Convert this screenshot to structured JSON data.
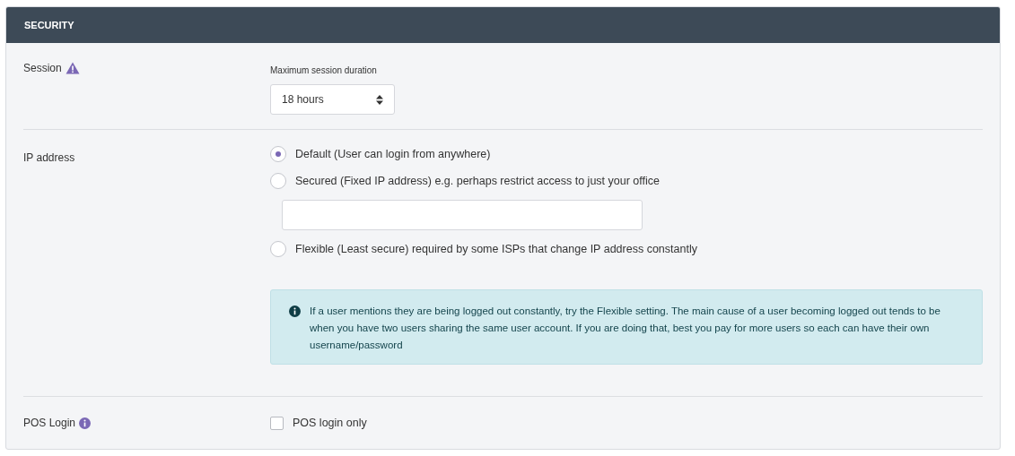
{
  "panel": {
    "title": "SECURITY"
  },
  "session": {
    "label": "Session",
    "field_label": "Maximum session duration",
    "value": "18 hours"
  },
  "ip_address": {
    "label": "IP address",
    "options": [
      {
        "label": "Default (User can login from anywhere)",
        "selected": true
      },
      {
        "label": "Secured (Fixed IP address) e.g. perhaps restrict access to just your office",
        "selected": false,
        "kind": "with_field"
      },
      {
        "label": "Flexible (Least secure) required by some ISPs that change IP address constantly",
        "selected": false
      }
    ],
    "note": "If a user mentions they are being logged out constantly, try the Flexible setting. The main cause of a user becoming logged out tends to be when you have two users sharing the same user account. If you are doing that, best you pay for more users so each can have their own username/password"
  },
  "pos_login": {
    "label": "POS Login",
    "option": "POS login only",
    "checked": false
  }
}
